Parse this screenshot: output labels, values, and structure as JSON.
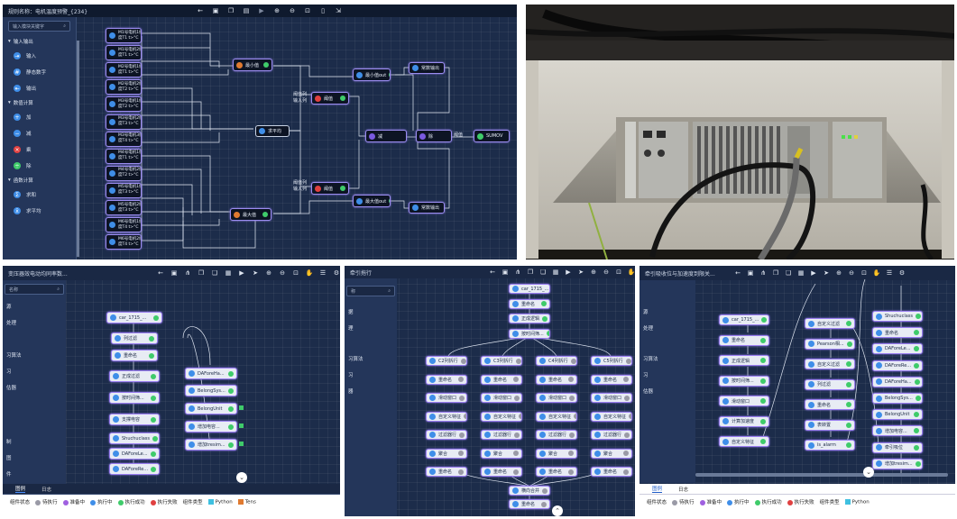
{
  "panel1": {
    "title": "规则名称：电机温度预警_{234}",
    "search_placeholder": "输入模块关键字",
    "categories": [
      {
        "label": "输入输出",
        "items": [
          "输入",
          "静态数字",
          "输出"
        ]
      },
      {
        "label": "数值计算",
        "items": [
          "加",
          "减",
          "乘",
          "除"
        ]
      },
      {
        "label": "函数计算",
        "items": [
          "求和",
          "求平均"
        ]
      }
    ],
    "input_nodes": [
      "M1号电机1绕\n度T1 t>°C",
      "M1号电机2绕\n度T1 t>°C",
      "M2号电机1绕\n度T1 t>°C",
      "M2号电机2绕\n度T2 t>°C",
      "M3号电机1绕\n度T2 t>°C",
      "M3号电机2绕\n度T3 t>°C",
      "M3号电机3绕\n度T4 t>°C",
      "M4号电机1绕\n度T1 t>°C",
      "M4号电机2绕\n度T2 t>°C",
      "M5号电机1绕\n度T3 t>°C",
      "M5号电机2绕\n度T3 t>°C",
      "M6号电机1绕\n度T4 t>°C",
      "M6号电机2绕\n度T4 t>°C"
    ],
    "nodes": {
      "min": "最小值",
      "max": "最大值",
      "avg": "求平均",
      "min_out": "最小值out",
      "max_out": "最大值out",
      "calc1": "阈值",
      "calc2": "阈值",
      "sub": "减",
      "div": "除",
      "output": "SUMOV",
      "const1": "常数输出",
      "const2": "常数输出",
      "label1": "阈值列\n输入列",
      "label2": "阈值列\n输入列",
      "label3": "阈值"
    }
  },
  "panel2": {
    "title": "变压器效电动均同率数...",
    "search_value": "名称",
    "sidebar": [
      "源",
      "处理",
      "习算法",
      "习",
      "估器",
      "",
      "",
      "制",
      "图",
      "件"
    ],
    "nodes": [
      "car_1715_...",
      "列过滤",
      "重命名",
      "正成过滤",
      "按时间筛...",
      "支撑电容",
      "Shuchuclass",
      "DAForeLe...",
      "DAForeRe...",
      "DAForeHa...",
      "BelongSys...",
      "BelongUnit",
      "增加电容...",
      "增加tresim..."
    ],
    "tabs": [
      "图例",
      "日志"
    ],
    "legend_label_status": "组件状态",
    "legend_items": [
      "待执行",
      "准备中",
      "执行中",
      "执行成功",
      "执行失败"
    ],
    "legend_type_label": "组件类型",
    "legend_types": [
      "Python",
      "Tens"
    ]
  },
  "panel3": {
    "title": "牵引拖行",
    "search_value": "称",
    "sidebar": [
      "据",
      "理",
      "",
      "习算法",
      "习",
      "器"
    ],
    "top_nodes": [
      "car_1715_...",
      "重命名",
      "正成逻辑",
      "按时间筛..."
    ],
    "columns": [
      [
        "C2列拆行",
        "重命名",
        "滑动窗口",
        "自定义特征",
        "过滤器行",
        "聚合",
        "重命名"
      ],
      [
        "C3列拆行",
        "重命名",
        "滑动窗口",
        "自定义特征",
        "过滤器行",
        "聚合",
        "重命名"
      ],
      [
        "C4列拆行",
        "重命名",
        "滑动窗口",
        "自定义特征",
        "过滤器行",
        "聚合",
        "重命名"
      ],
      [
        "C5列拆行",
        "重命名",
        "滑动窗口",
        "自定义特征",
        "过滤器行",
        "聚合",
        "重命名"
      ]
    ],
    "bottom_nodes": [
      "横向合并",
      "重命名"
    ]
  },
  "panel4": {
    "title": "牵引吸收位与加速度到限关...",
    "sidebar": [
      "源",
      "处理",
      "",
      "习算法",
      "习",
      "估器"
    ],
    "col1": [
      "car_1715_...",
      "重命名",
      "正成逻辑",
      "按时间筛...",
      "滑动窗口",
      "计算加速度",
      "自定义特征"
    ],
    "col2": [
      "自定义过滤",
      "Pearson相...",
      "自定义过滤",
      "列过滤",
      "重命名",
      "表转置",
      "is_alarm"
    ],
    "col3": [
      "Shuchuclass",
      "重命名",
      "DAForeLe...",
      "DAForeRe...",
      "DAForeHa...",
      "BelongSys...",
      "BelongUnit",
      "增加电容...",
      "牵引吸位",
      "增加tresim..."
    ],
    "tabs": [
      "图例",
      "日志"
    ],
    "legend_label_status": "组件状态",
    "legend_items": [
      "待执行",
      "准备中",
      "执行中",
      "执行成功",
      "执行失败"
    ],
    "legend_type_label": "组件类型",
    "legend_types": [
      "Python"
    ]
  },
  "colors": {
    "canvas_bg": "#1c2c4a",
    "sidebar_bg": "#24365a",
    "success": "#3fcb6a",
    "running": "#3f8ee8",
    "pending": "#9a9aa6",
    "preparing": "#a060e0",
    "failed": "#e04040",
    "accent": "#9a7ef0"
  }
}
